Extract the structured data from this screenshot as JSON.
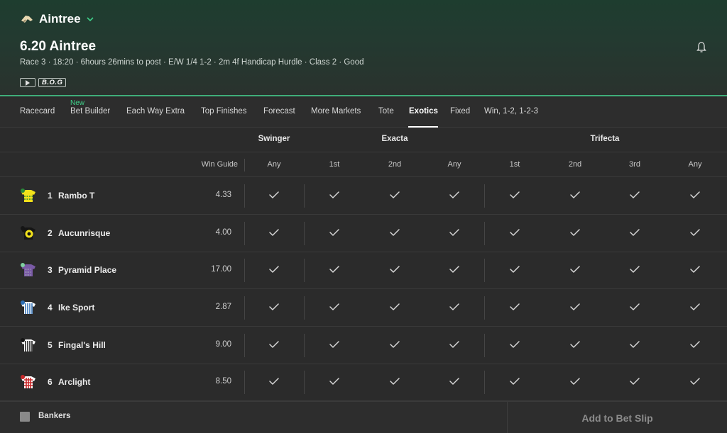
{
  "header": {
    "venue": "Aintree",
    "race_title": "6.20 Aintree",
    "race_info": "Race 3 · 18:20 · 6hours 26mins to post · E/W 1/4 1-2 · 2m 4f Handicap Hurdle · Class 2 · Good",
    "badge_bog": "B.O.G"
  },
  "tabs": {
    "new_badge": "New",
    "items": [
      {
        "label": "Racecard"
      },
      {
        "label": "Bet Builder"
      },
      {
        "label": "Each Way Extra"
      },
      {
        "label": "Top Finishes"
      },
      {
        "label": "Forecast"
      },
      {
        "label": "More Markets"
      },
      {
        "label": "Tote"
      },
      {
        "label": "Exotics",
        "active": true
      },
      {
        "label": "Fixed"
      },
      {
        "label": "Win, 1-2, 1-2-3"
      }
    ]
  },
  "groups": {
    "swinger": "Swinger",
    "exacta": "Exacta",
    "trifecta": "Trifecta"
  },
  "columns": {
    "win_guide": "Win Guide",
    "swinger_any": "Any",
    "exacta_1st": "1st",
    "exacta_2nd": "2nd",
    "exacta_any": "Any",
    "trifecta_1st": "1st",
    "trifecta_2nd": "2nd",
    "trifecta_3rd": "3rd",
    "trifecta_any": "Any"
  },
  "runners": [
    {
      "number": "1",
      "name": "Rambo T",
      "win_guide": "4.33",
      "silk": "yellow-green"
    },
    {
      "number": "2",
      "name": "Aucunrisque",
      "win_guide": "4.00",
      "silk": "black-yellow"
    },
    {
      "number": "3",
      "name": "Pyramid Place",
      "win_guide": "17.00",
      "silk": "purple-green"
    },
    {
      "number": "4",
      "name": "Ike Sport",
      "win_guide": "2.87",
      "silk": "blue-white"
    },
    {
      "number": "5",
      "name": "Fingal's Hill",
      "win_guide": "9.00",
      "silk": "black-white"
    },
    {
      "number": "6",
      "name": "Arclight",
      "win_guide": "8.50",
      "silk": "red-white"
    }
  ],
  "footer": {
    "bankers": "Bankers",
    "add_to_slip": "Add to Bet Slip"
  },
  "colors": {
    "accent_green": "#3fae7a",
    "new_badge": "#3fd08a",
    "background": "#2b2b2b"
  }
}
